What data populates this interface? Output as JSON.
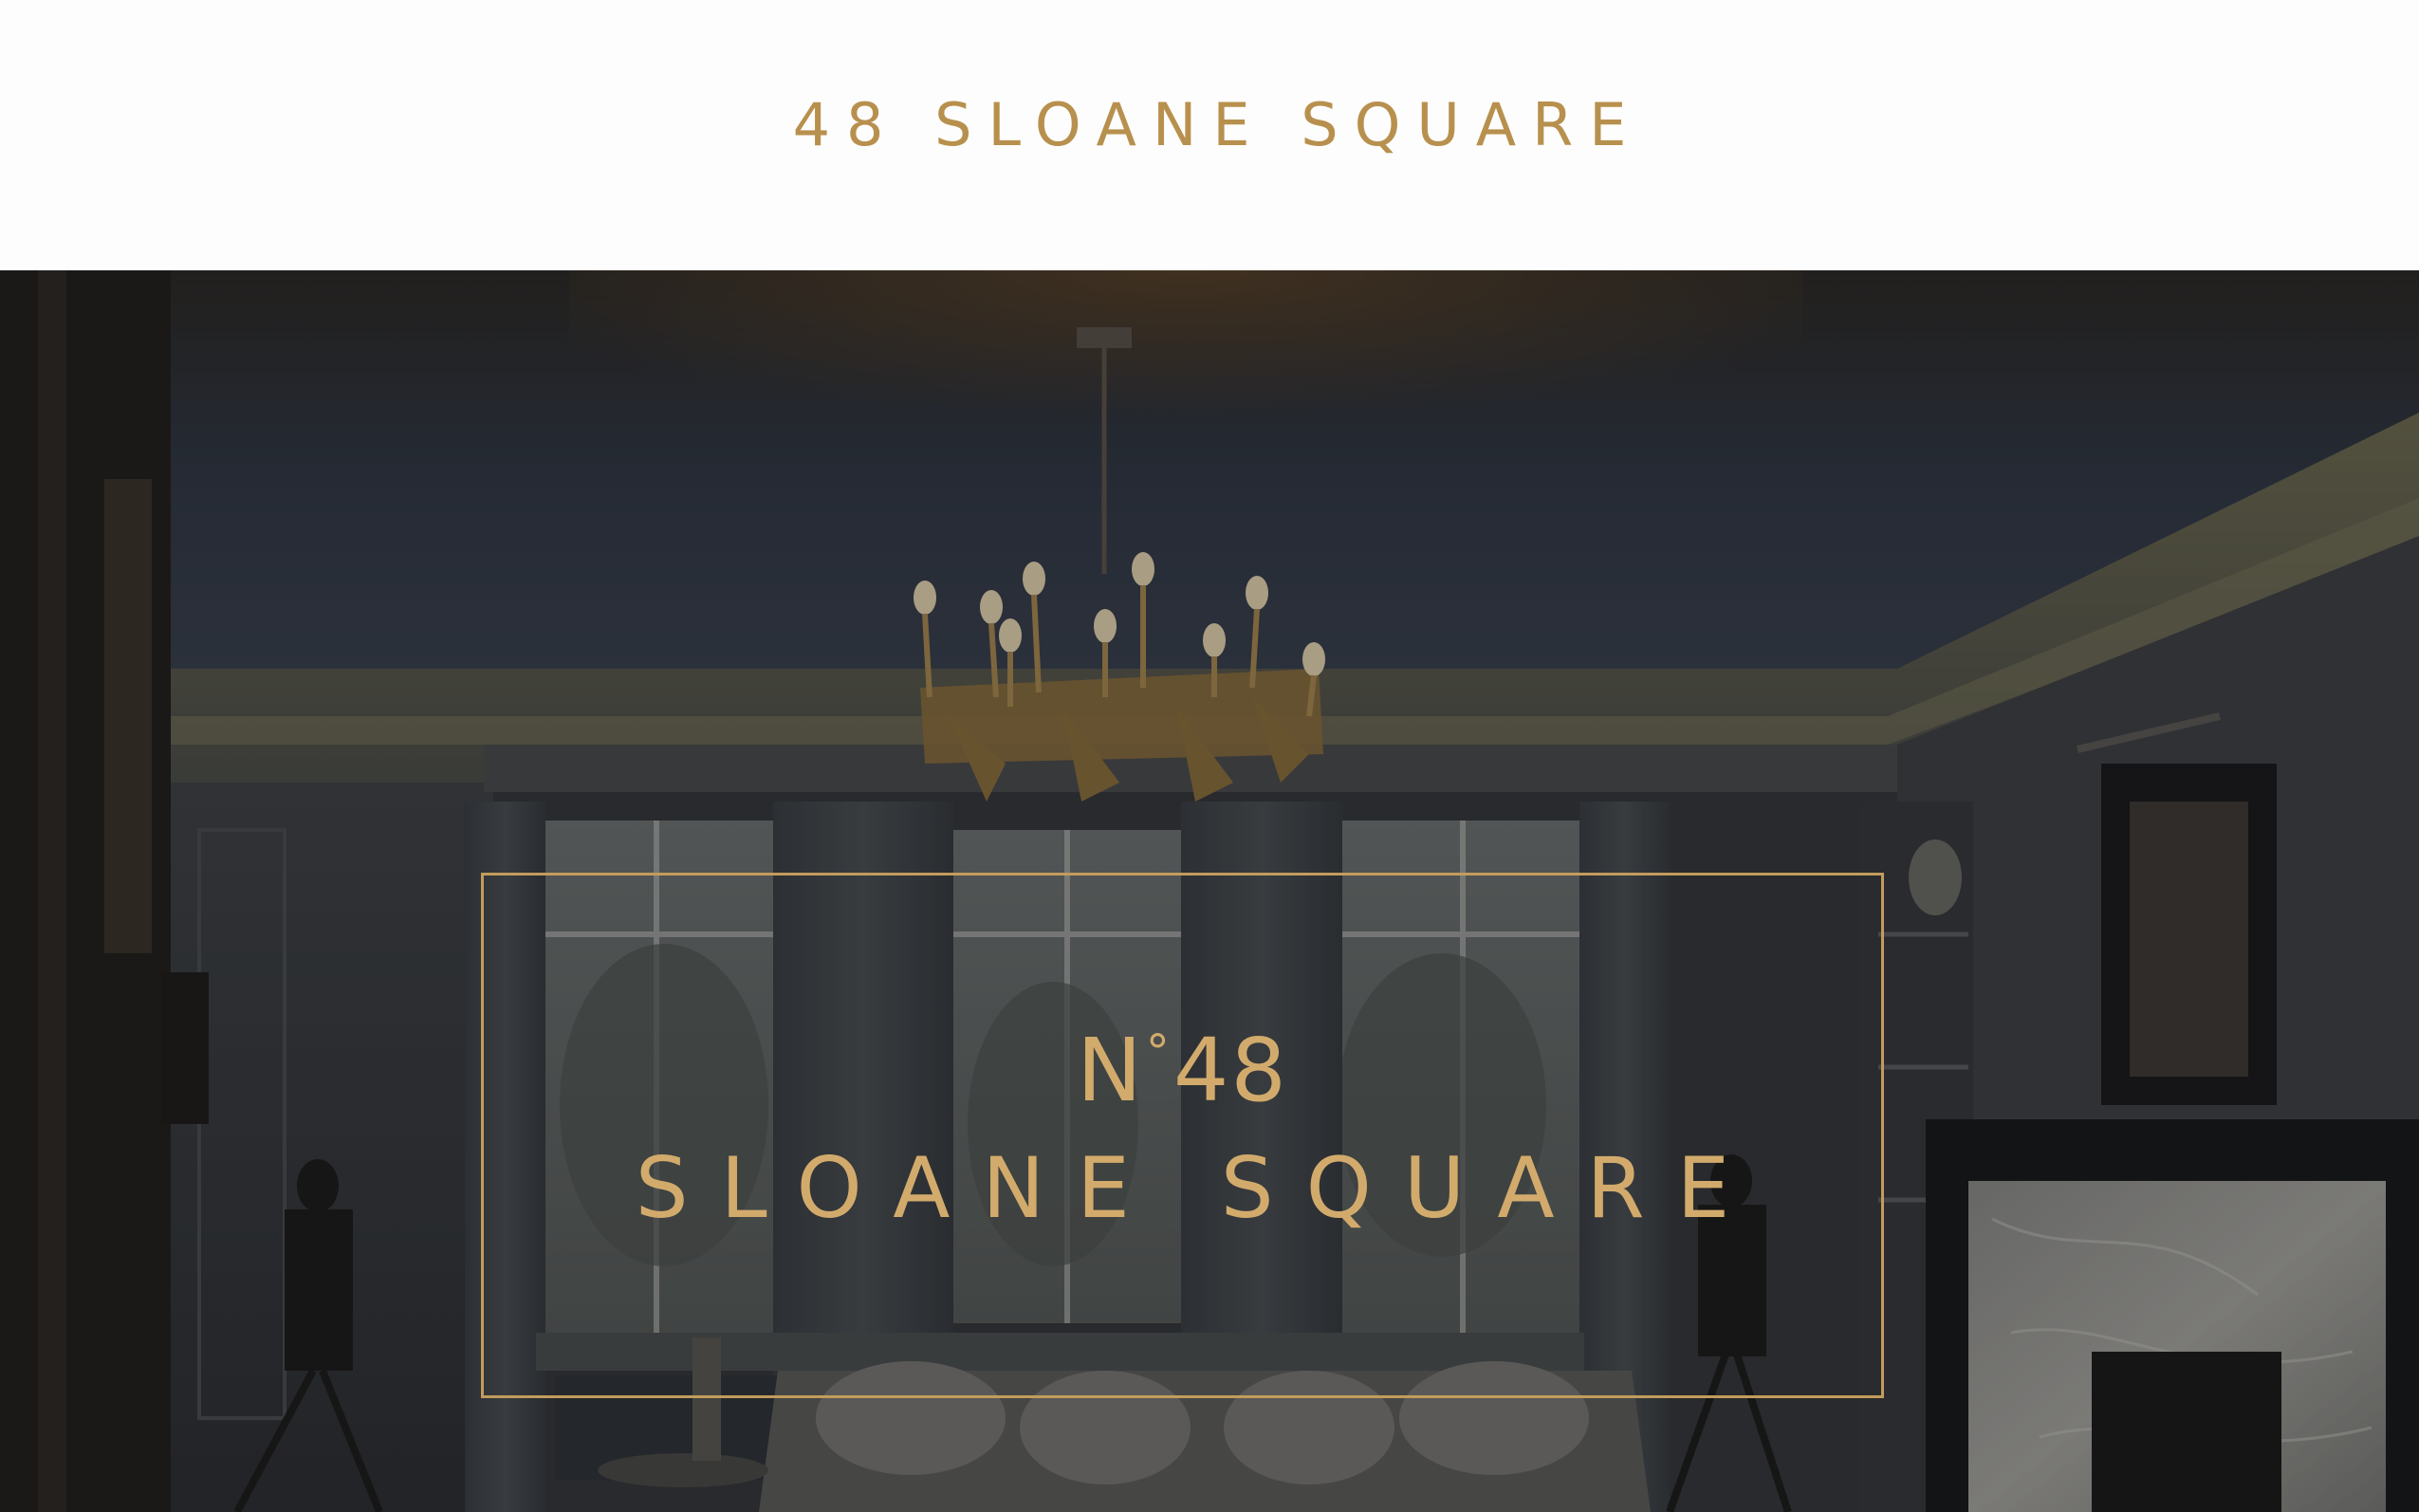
{
  "header": {
    "logo_text": "48 SLOANE SQUARE"
  },
  "hero": {
    "image_alt": "Drawing room with chandelier, bay windows and marble fireplace",
    "title_prefix": "N",
    "title_degree": "°",
    "title_number": "48",
    "title_name": "SLOANE SQUARE"
  },
  "colors": {
    "accent_gold": "#b8904e",
    "hero_gold": "#d2ab6c",
    "frame_gold": "#c29c5c",
    "header_bg": "#fdfdfd"
  },
  "icons": {
    "chandelier": "chandelier-illustration",
    "fireplace": "fireplace-illustration"
  }
}
